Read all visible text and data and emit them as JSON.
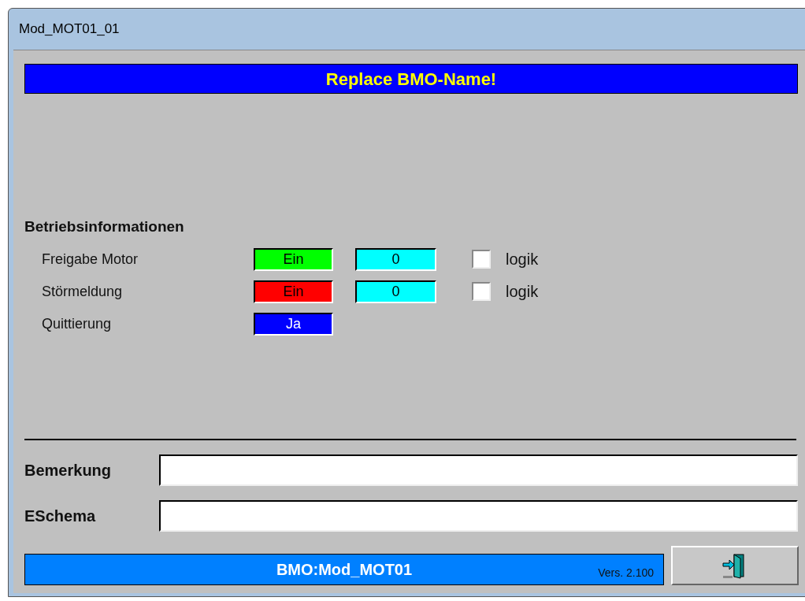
{
  "window": {
    "title": "Mod_MOT01_01"
  },
  "header": "Replace BMO-Name!",
  "section": "Betriebsinformationen",
  "rows": [
    {
      "label": "Freigabe Motor",
      "status": "Ein",
      "color": "#00ff00",
      "counter": "0",
      "checked": false,
      "checkbox_label": "logik"
    },
    {
      "label": "Störmeldung",
      "status": "Ein",
      "color": "#ff0000",
      "counter": "0",
      "checked": false,
      "checkbox_label": "logik"
    },
    {
      "label": "Quittierung",
      "status": "Ja",
      "color": "#0000ff"
    }
  ],
  "fields": [
    {
      "label": "Bemerkung"
    },
    {
      "label": "ESchema"
    }
  ],
  "footer": {
    "name": "BMO:Mod_MOT01",
    "version": "Vers. 2.100"
  }
}
